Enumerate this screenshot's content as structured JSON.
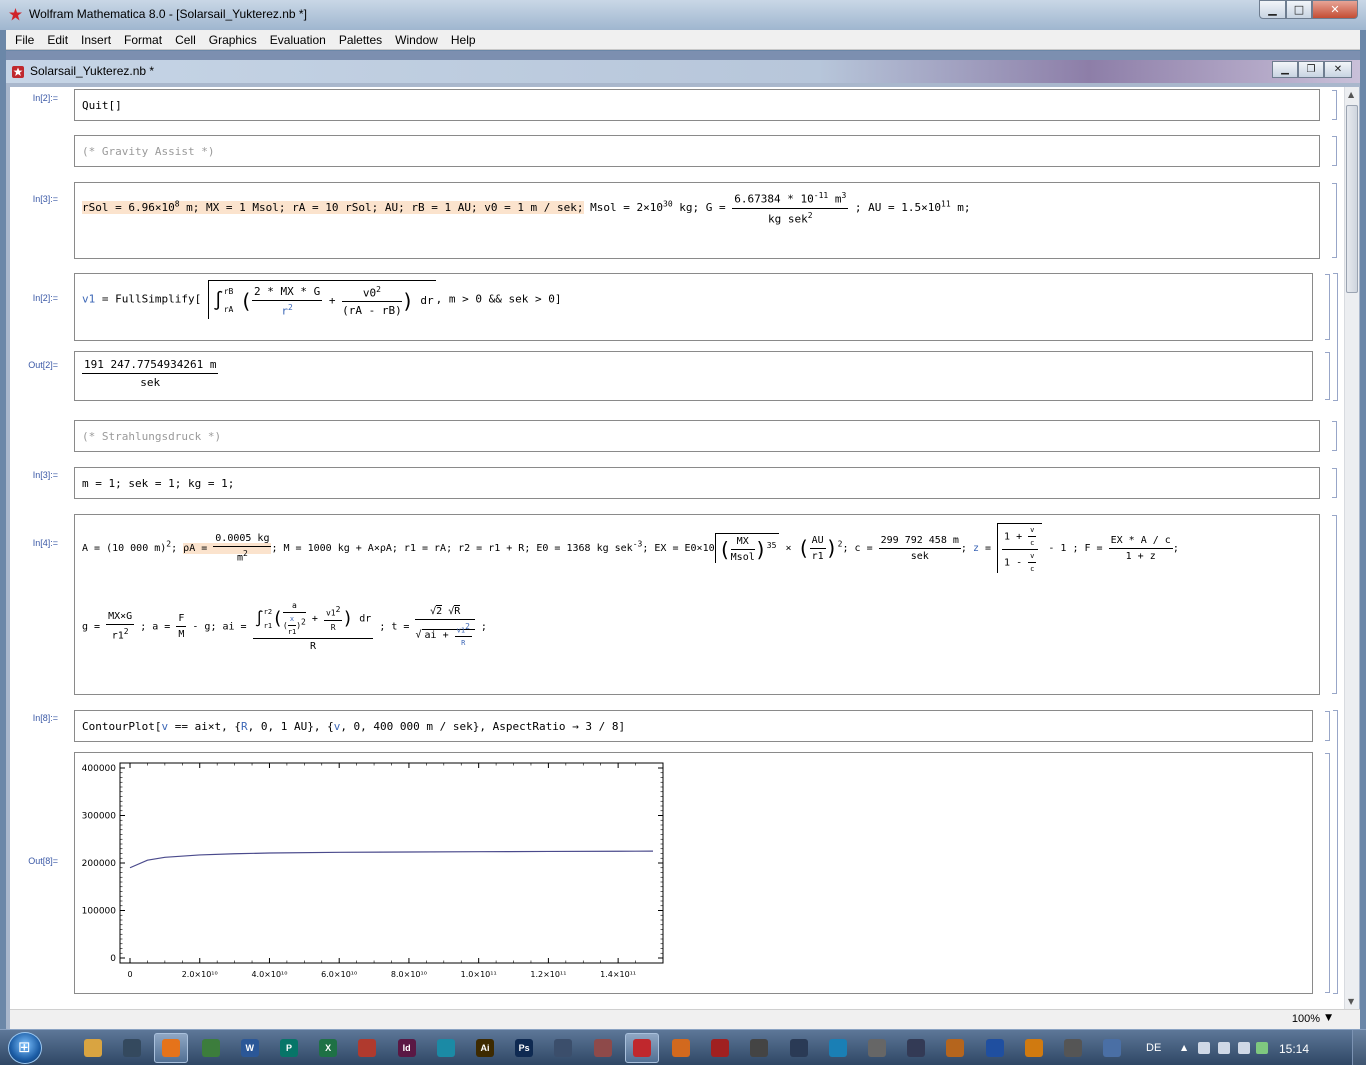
{
  "app": {
    "title": "Wolfram Mathematica 8.0 - [Solarsail_Yukterez.nb *]",
    "notebook_tab": "Solarsail_Yukterez.nb *",
    "zoom": "100%"
  },
  "menu": [
    "File",
    "Edit",
    "Insert",
    "Format",
    "Cell",
    "Graphics",
    "Evaluation",
    "Palettes",
    "Window",
    "Help"
  ],
  "cells": {
    "c1": {
      "label": "In[2]:=",
      "text": "Quit[]"
    },
    "c2": {
      "text": "(* Gravity Assist *)"
    },
    "c3": {
      "label": "In[3]:=",
      "p1": "rSol = 6.96×10",
      "p1sup": "8",
      "p1b": " m;",
      "p2": " MX = 1 Msol; rA = 10 rSol; AU; rB = 1 AU;",
      "p3": " v0 = 1 m / sek;",
      "p4": " Msol = 2×10",
      "p4sup": "30",
      "p4b": " kg; G = ",
      "num": "6.67384 * 10",
      "numsup": "-11",
      "numb": " m",
      "numsup2": "3",
      "den": "kg sek",
      "densup": "2",
      "p5": " ; AU = 1.5×10",
      "p5sup": "11",
      "p5b": " m;"
    },
    "c4": {
      "label": "In[2]:=",
      "pre": "v1",
      "eq": " = FullSimplify[",
      "lim_up": "rB",
      "lim_lo": "rA",
      "n1": "2 * MX * G",
      "d1": "r",
      "d1sup": "2",
      "plus": "+",
      "n2": "v0",
      "n2sup": "2",
      "d2": "(rA - rB)",
      "dr": "dr",
      "post": ", m > 0 && sek > 0]"
    },
    "c5": {
      "label": "Out[2]=",
      "num": "191 247.7754934261 m",
      "den": "sek"
    },
    "c6": {
      "text": "(* Strahlungsdruck *)"
    },
    "c7": {
      "label": "In[3]:=",
      "text": "m = 1; sek = 1; kg = 1;"
    },
    "c8": {
      "label": "In[4]:=",
      "l1a": "A = (10 000 m)",
      "l1asup": "2",
      "l1b": "; ",
      "rho": "ρA = ",
      "rho_num": "0.0005 kg",
      "rho_den": "m",
      "rho_densup": "2",
      "l1c": "; M = 1000 kg + A×ρA; r1 = rA;  r2 = r1 + R;  E0 = 1368 kg sek",
      "l1csup": "-3",
      "l1d": "; EX = E0×",
      "ex_num": "MX",
      "ex_den": "Msol",
      "ex_pow": "35",
      "ex_base": "10",
      "times": "×",
      "au_num": "AU",
      "au_den": "r1",
      "au_sup": "2",
      "l1e": "; c = ",
      "c_num": "299 792 458 m",
      "c_den": "sek",
      "l1f": "; ",
      "z": "z",
      "l1g": " = ",
      "z_n1": "1 + ",
      "z_nf": "v",
      "z_nd": "c",
      "z_d1": "1 - ",
      "z_df": "v",
      "z_dd": "c",
      "l1h": " - 1 ; F = ",
      "f_num": "EX * A / c",
      "f_den": "1 + z",
      "l1i": ";",
      "l2a": "g = ",
      "g_num": "MX×G",
      "g_den": "r1",
      "g_densup": "2",
      "l2b": " ; a = ",
      "a_num": "F",
      "a_den": "M",
      "l2c": " - g; ai = ",
      "ai_up": "r2",
      "ai_lo": "r1",
      "ai_n": "a",
      "ai_dx": "x",
      "ai_dr": "r1",
      "ai_dsup": "2",
      "ai_plus": "+",
      "ai_vn": "v1",
      "ai_vsup": "2",
      "ai_vd": "R",
      "ai_dr2": "dr",
      "ai_den": "R",
      "l2d": " ; t = ",
      "t_num1": "2",
      "t_num2": "R",
      "t_den": "ai + ",
      "t_fn": "v1",
      "t_fsup": "2",
      "t_fd": "R",
      "l2e": " ;"
    },
    "c9": {
      "label": "In[8]:=",
      "a": "ContourPlot[",
      "v": "v",
      "b": " == ai×t, {",
      "R": "R",
      "c": ", 0, 1 AU}, {",
      "v2": "v",
      "d": ", 0, 400 000 m / sek}, AspectRatio → 3 / 8]"
    },
    "c10": {
      "label": "Out[8]="
    }
  },
  "chart_data": {
    "type": "line",
    "title": "",
    "xlabel": "",
    "ylabel": "",
    "xlim": [
      0,
      150000000000.0
    ],
    "ylim": [
      0,
      400000
    ],
    "x_ticks": [
      "0",
      "2.0×10¹⁰",
      "4.0×10¹⁰",
      "6.0×10¹⁰",
      "8.0×10¹⁰",
      "1.0×10¹¹",
      "1.2×10¹¹",
      "1.4×10¹¹"
    ],
    "x_tick_values": [
      0,
      20000000000.0,
      40000000000.0,
      60000000000.0,
      80000000000.0,
      100000000000.0,
      120000000000.0,
      140000000000.0
    ],
    "y_ticks": [
      "0",
      "100000",
      "200000",
      "300000",
      "400000"
    ],
    "y_tick_values": [
      0,
      100000,
      200000,
      300000,
      400000
    ],
    "series": [
      {
        "color": "#4a4a8c",
        "x": [
          0,
          5000000000.0,
          10000000000.0,
          20000000000.0,
          30000000000.0,
          40000000000.0,
          60000000000.0,
          80000000000.0,
          100000000000.0,
          120000000000.0,
          140000000000.0,
          150000000000.0
        ],
        "y": [
          190000,
          206000,
          212000,
          217000,
          219500,
          221000,
          222500,
          223200,
          223800,
          224300,
          224700,
          225000
        ]
      }
    ]
  },
  "taskbar": {
    "items": [
      {
        "name": "explorer",
        "label": "",
        "color": "#d9a441"
      },
      {
        "name": "media",
        "label": "",
        "color": "#34495e"
      },
      {
        "name": "firefox",
        "label": "",
        "color": "#e5731a"
      },
      {
        "name": "app3",
        "label": "",
        "color": "#3c7d3c"
      },
      {
        "name": "word",
        "label": "W",
        "color": "#2b5797"
      },
      {
        "name": "publisher",
        "label": "P",
        "color": "#077568"
      },
      {
        "name": "excel",
        "label": "X",
        "color": "#1e7145"
      },
      {
        "name": "app7",
        "label": "",
        "color": "#b03a2e"
      },
      {
        "name": "indesign",
        "label": "Id",
        "color": "#5a1844"
      },
      {
        "name": "app9",
        "label": "",
        "color": "#1b8aa5"
      },
      {
        "name": "illustrator",
        "label": "Ai",
        "color": "#3d2a00"
      },
      {
        "name": "photoshop",
        "label": "Ps",
        "color": "#0f2a52"
      },
      {
        "name": "app12",
        "label": "",
        "color": "#3b4e6b"
      },
      {
        "name": "app13",
        "label": "",
        "color": "#8e4a4a"
      },
      {
        "name": "mathematica",
        "label": "",
        "color": "#c0282d"
      },
      {
        "name": "matlab",
        "label": "",
        "color": "#d2691e"
      },
      {
        "name": "app16",
        "label": "",
        "color": "#a02020"
      },
      {
        "name": "app17",
        "label": "",
        "color": "#444"
      },
      {
        "name": "app18",
        "label": "",
        "color": "#2a3a55"
      },
      {
        "name": "app19",
        "label": "",
        "color": "#1a7fb5"
      },
      {
        "name": "app20",
        "label": "",
        "color": "#666"
      },
      {
        "name": "app21",
        "label": "",
        "color": "#333a55"
      },
      {
        "name": "app22",
        "label": "",
        "color": "#b5651d"
      },
      {
        "name": "app23",
        "label": "",
        "color": "#1f4fa0"
      },
      {
        "name": "app24",
        "label": "",
        "color": "#d07a10"
      },
      {
        "name": "app25",
        "label": "",
        "color": "#555"
      },
      {
        "name": "app26",
        "label": "",
        "color": "#4a6fa5"
      }
    ],
    "lang": "DE",
    "clock": "15:14"
  }
}
